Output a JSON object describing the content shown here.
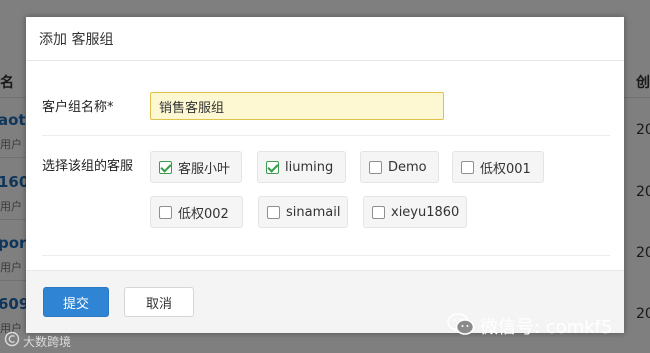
{
  "background": {
    "left_header": "名",
    "left_items": [
      "aot",
      "用户",
      "160",
      "用户",
      "por",
      "用户",
      "609",
      "用户"
    ],
    "right_header": "创",
    "right_items": [
      "20",
      "20",
      "20",
      "20"
    ]
  },
  "modal": {
    "title": "添加 客服组",
    "group_name_label": "客户组名称*",
    "group_name_value": "销售客服组",
    "select_label": "选择该组的客服",
    "agents": [
      {
        "label": "客服小叶",
        "checked": true
      },
      {
        "label": "liuming",
        "checked": true
      },
      {
        "label": "Demo",
        "checked": false
      },
      {
        "label": "低权001",
        "checked": false
      },
      {
        "label": "低权002",
        "checked": false
      },
      {
        "label": "sinamail",
        "checked": false
      },
      {
        "label": "xieyu1860",
        "checked": false
      }
    ],
    "submit_label": "提交",
    "cancel_label": "取消"
  },
  "watermark": {
    "wechat_text": "微信号: comkf5",
    "source_text": "大数跨境"
  },
  "colors": {
    "accent": "#2f84d3",
    "input_highlight": "#fdf8d2",
    "check_green": "#2f9e44"
  }
}
